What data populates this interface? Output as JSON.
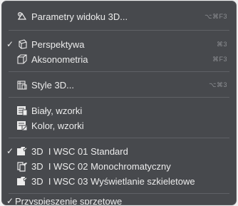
{
  "menu": {
    "items": [
      {
        "label": "Parametry widoku 3D...",
        "shortcut": "⌥⌘F3",
        "icon": "view-settings-icon",
        "checked": ""
      },
      {
        "label": "Perspektywa",
        "shortcut": "⌘3",
        "icon": "perspective-cube-icon",
        "checked": "✓"
      },
      {
        "label": "Aksonometria",
        "shortcut": "⌘F3",
        "icon": "axonometric-cube-icon",
        "checked": ""
      },
      {
        "label": "Style 3D...",
        "shortcut": "⌥⌘3",
        "icon": "style-3d-icon",
        "checked": ""
      },
      {
        "label": "Biały, wzorki",
        "shortcut": "",
        "icon": "white-pattern-icon",
        "checked": ""
      },
      {
        "label": "Kolor, wzorki",
        "shortcut": "",
        "icon": "color-pattern-icon",
        "checked": ""
      },
      {
        "label": "3D  I WSC 01 Standard",
        "shortcut": "",
        "icon": "style-folder-icon",
        "checked": "✓"
      },
      {
        "label": "3D  I WSC 02 Monochromatyczny",
        "shortcut": "",
        "icon": "style-folder-icon",
        "checked": ""
      },
      {
        "label": "3D  I WSC 03 Wyświetlanie szkieletowe",
        "shortcut": "",
        "icon": "style-folder-icon",
        "checked": ""
      },
      {
        "label": "Przyspieszenie sprzętowe",
        "shortcut": "",
        "icon": "",
        "checked": "✓"
      }
    ]
  }
}
